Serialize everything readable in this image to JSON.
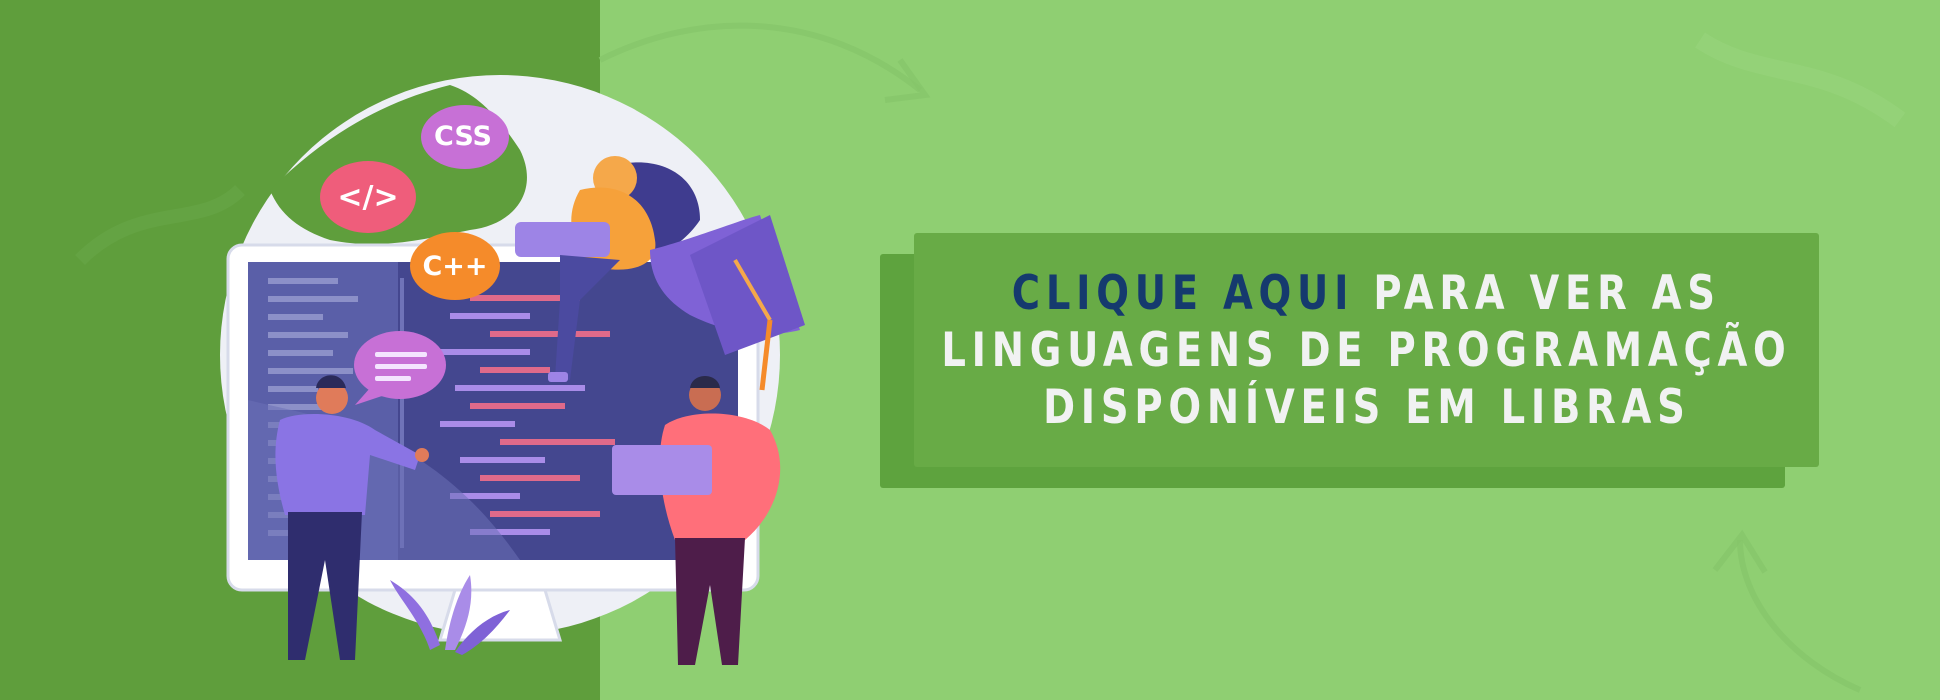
{
  "banner": {
    "language_bubbles": {
      "css": "CSS",
      "html": "</>",
      "cpp": "C++"
    },
    "cta": {
      "highlight": "CLIQUE AQUI",
      "line1_rest": " PARA VER AS",
      "line2": "LINGUAGENS DE PROGRAMAÇÃO",
      "line3": "DISPONÍVEIS EM LIBRAS"
    },
    "colors": {
      "background": "#8fcf72",
      "left_panel": "#5f9e3c",
      "cta_box": "#68ab46",
      "cta_highlight": "#153a6e",
      "cta_text": "#f1f2f2"
    }
  }
}
